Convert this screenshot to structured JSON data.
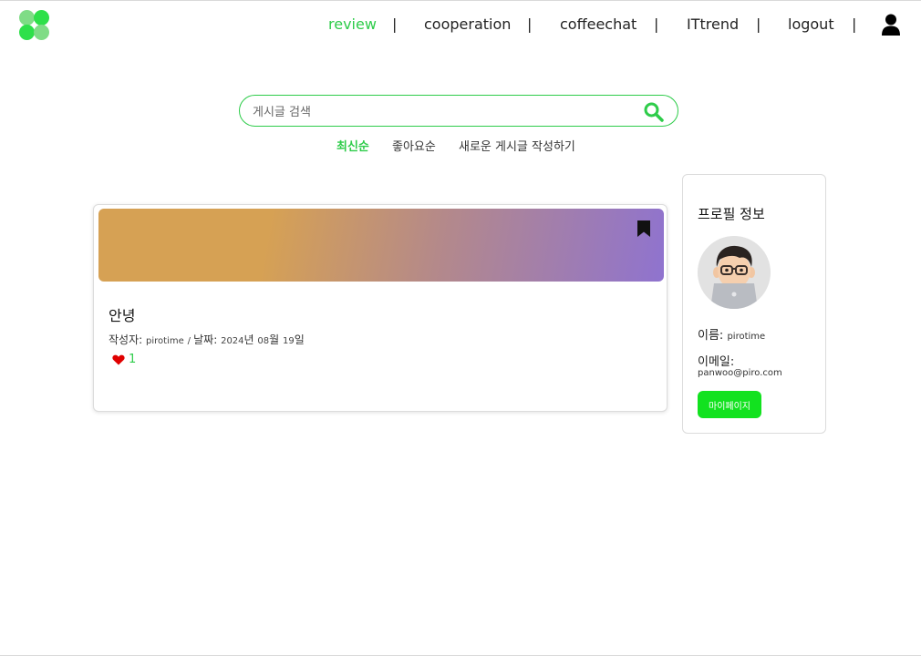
{
  "header": {
    "nav": [
      {
        "label": "review",
        "active": true
      },
      {
        "label": "cooperation",
        "active": false
      },
      {
        "label": "coffeechat",
        "active": false
      },
      {
        "label": "ITtrend",
        "active": false
      },
      {
        "label": "logout",
        "active": false
      }
    ],
    "separator": "|",
    "icons": {
      "logo": "clover-logo-icon",
      "user": "user-icon"
    }
  },
  "search": {
    "placeholder": "게시글 검색",
    "value": "",
    "icon": "search-icon"
  },
  "sort": {
    "latest": "최신순",
    "popular": "좋아요순",
    "new_post": "새로운 게시글 작성하기",
    "active": "latest"
  },
  "post": {
    "title": "안녕",
    "author_label": "작성자:",
    "author": "pirotime",
    "date_sep": " / ",
    "date_label": "날짜:",
    "date_year": "2024",
    "date_year_unit": "년 ",
    "date_month": "08",
    "date_month_unit": "월 ",
    "date_day": "19",
    "date_day_unit": "일",
    "likes": "1",
    "icons": {
      "bookmark": "bookmark-icon",
      "like": "heart-icon"
    }
  },
  "profile": {
    "title": "프로필 정보",
    "name_label": "이름:",
    "name": "pirotime",
    "email_label": "이메일:",
    "email": "panwoo@piro.com",
    "mypage_button": "마이페이지",
    "avatar_icon": "memoji-avatar-icon"
  },
  "colors": {
    "accent": "#2ecc4a",
    "button": "#12e21f",
    "heart": "#e00000",
    "banner_start": "#d6a154",
    "banner_end": "#8f73cf"
  }
}
